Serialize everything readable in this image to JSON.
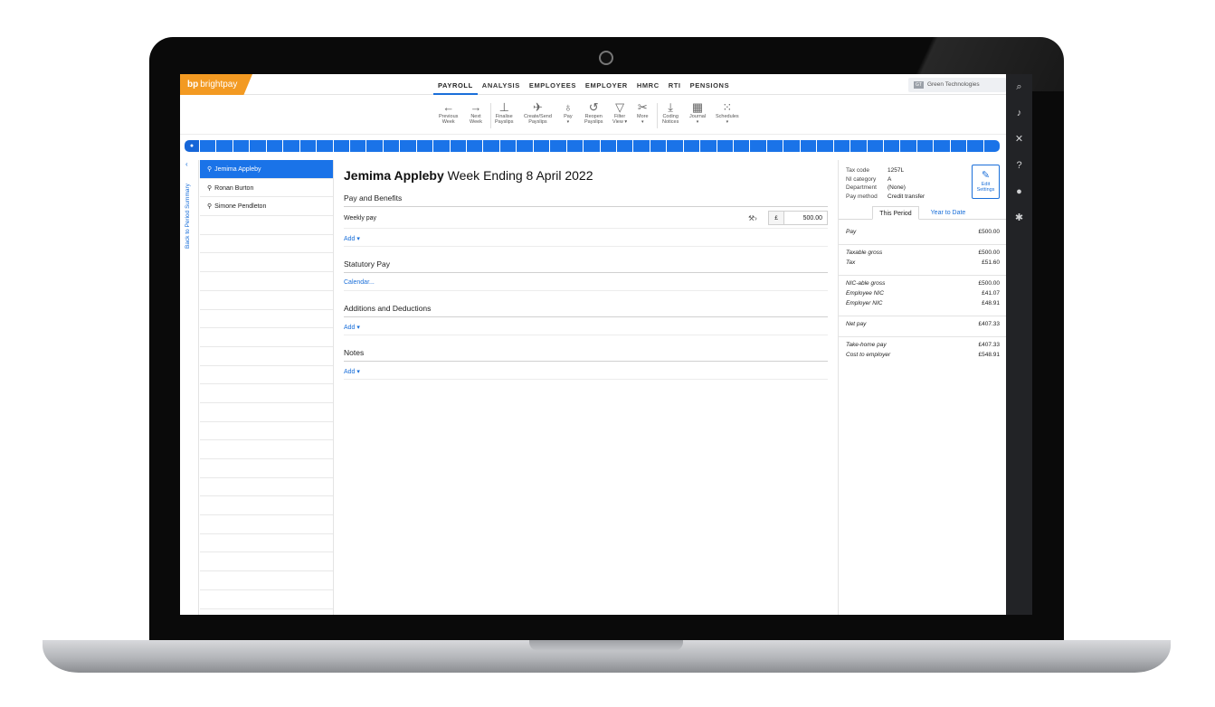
{
  "app": {
    "logo": "brightpay",
    "company": "Green Technologies",
    "company_initials": "GT"
  },
  "nav": [
    "PAYROLL",
    "ANALYSIS",
    "EMPLOYEES",
    "EMPLOYER",
    "HMRC",
    "RTI",
    "PENSIONS"
  ],
  "toolbar": {
    "previous_week": [
      "Previous",
      "Week"
    ],
    "next_week": [
      "Next",
      "Week"
    ],
    "finalise": [
      "Finalise",
      "Payslips"
    ],
    "create_send": [
      "Create/Send",
      "Payslips"
    ],
    "pay": "Pay",
    "reopen": [
      "Reopen",
      "Payslips"
    ],
    "filter": [
      "Filter",
      "View"
    ],
    "more": "More",
    "coding": [
      "Coding",
      "Notices"
    ],
    "journal": "Journal",
    "schedules": "Schedules"
  },
  "sidebar": {
    "back_label": "Back to Period Summary"
  },
  "employees": [
    "Jemima Appleby",
    "Ronan Burton",
    "Simone Pendleton"
  ],
  "main": {
    "employee_name": "Jemima Appleby",
    "period_title": "Week Ending 8 April 2022",
    "sections": {
      "pay_benefits": "Pay and Benefits",
      "statutory": "Statutory Pay",
      "additions": "Additions and Deductions",
      "notes": "Notes"
    },
    "weekly_pay_label": "Weekly pay",
    "currency": "£",
    "weekly_pay_value": "500.00",
    "add_label": "Add",
    "calendar_label": "Calendar..."
  },
  "details": {
    "tax_code_label": "Tax code",
    "tax_code": "1257L",
    "ni_label": "NI category",
    "ni": "A",
    "dept_label": "Department",
    "dept": "(None)",
    "method_label": "Pay method",
    "method": "Credit transfer",
    "edit_label": [
      "Edit",
      "Settings"
    ]
  },
  "tabs": {
    "this_period": "This Period",
    "ytd": "Year to Date"
  },
  "summary": {
    "pay": [
      "Pay",
      "£500.00"
    ],
    "taxable": [
      "Taxable gross",
      "£500.00"
    ],
    "tax": [
      "Tax",
      "£51.60"
    ],
    "nic_gross": [
      "NIC-able gross",
      "£500.00"
    ],
    "ee_nic": [
      "Employee NIC",
      "£41.07"
    ],
    "er_nic": [
      "Employer NIC",
      "£48.91"
    ],
    "net": [
      "Net pay",
      "£407.33"
    ],
    "take_home": [
      "Take-home pay",
      "£407.33"
    ],
    "cost": [
      "Cost to employer",
      "£548.91"
    ]
  },
  "colors": {
    "accent": "#1a73e8",
    "brand": "#f39a22",
    "sidebar_dark": "#222326"
  }
}
